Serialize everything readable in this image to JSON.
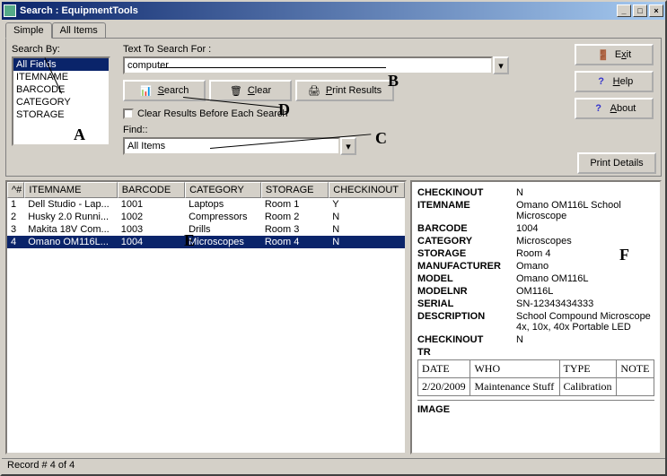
{
  "window": {
    "title": "Search : EquipmentTools"
  },
  "tabs": [
    "Simple",
    "All Items"
  ],
  "searchby": {
    "label": "Search By:",
    "items": [
      "All Fields",
      "ITEMNAME",
      "BARCODE",
      "CATEGORY",
      "STORAGE"
    ],
    "selected": 0
  },
  "searchtext": {
    "label": "Text To Search For :",
    "value": "computer"
  },
  "buttons": {
    "search": "Search",
    "clear": "Clear",
    "print": "Print Results",
    "exit": "Exit",
    "help": "Help",
    "about": "About",
    "printdetails": "Print Details"
  },
  "checkbox": {
    "label": "Clear Results Before Each Search",
    "checked": false
  },
  "find": {
    "label": "Find::",
    "value": "All Items"
  },
  "grid": {
    "cols": [
      "^#",
      "ITEMNAME",
      "BARCODE",
      "CATEGORY",
      "STORAGE",
      "CHECKINOUT"
    ],
    "rows": [
      {
        "n": "1",
        "name": "Dell Studio - Lap...",
        "barcode": "1001",
        "cat": "Laptops",
        "storage": "Room 1",
        "chk": "Y"
      },
      {
        "n": "2",
        "name": "Husky 2.0 Runni...",
        "barcode": "1002",
        "cat": "Compressors",
        "storage": "Room 2",
        "chk": "N"
      },
      {
        "n": "3",
        "name": "Makita 18V Com...",
        "barcode": "1003",
        "cat": "Drills",
        "storage": "Room 3",
        "chk": "N"
      },
      {
        "n": "4",
        "name": "Omano OM116L...",
        "barcode": "1004",
        "cat": "Microscopes",
        "storage": "Room 4",
        "chk": "N"
      }
    ],
    "selected": 3
  },
  "details": {
    "fields": [
      {
        "k": "CHECKINOUT",
        "v": "N"
      },
      {
        "k": "ITEMNAME",
        "v": "Omano OM116L School Microscope"
      },
      {
        "k": "BARCODE",
        "v": "1004"
      },
      {
        "k": "CATEGORY",
        "v": "Microscopes"
      },
      {
        "k": "STORAGE",
        "v": "Room 4"
      },
      {
        "k": "MANUFACTURER",
        "v": "Omano"
      },
      {
        "k": "MODEL",
        "v": "Omano OM116L"
      },
      {
        "k": "MODELNR",
        "v": "OM116L"
      },
      {
        "k": "SERIAL",
        "v": "SN-12343434333"
      },
      {
        "k": "DESCRIPTION",
        "v": "School Compound Microscope 4x, 10x, 40x Portable LED"
      },
      {
        "k": "CHECKINOUT",
        "v": "N"
      }
    ],
    "tr_label": "TR",
    "tr_cols": [
      "DATE",
      "WHO",
      "TYPE",
      "NOTE"
    ],
    "tr_rows": [
      {
        "date": "2/20/2009",
        "who": "Maintenance Stuff",
        "type": "Calibration",
        "note": ""
      }
    ],
    "image_label": "IMAGE"
  },
  "status": "Record # 4 of 4",
  "markers": {
    "A": "A",
    "B": "B",
    "C": "C",
    "D": "D",
    "E": "E",
    "F": "F"
  }
}
